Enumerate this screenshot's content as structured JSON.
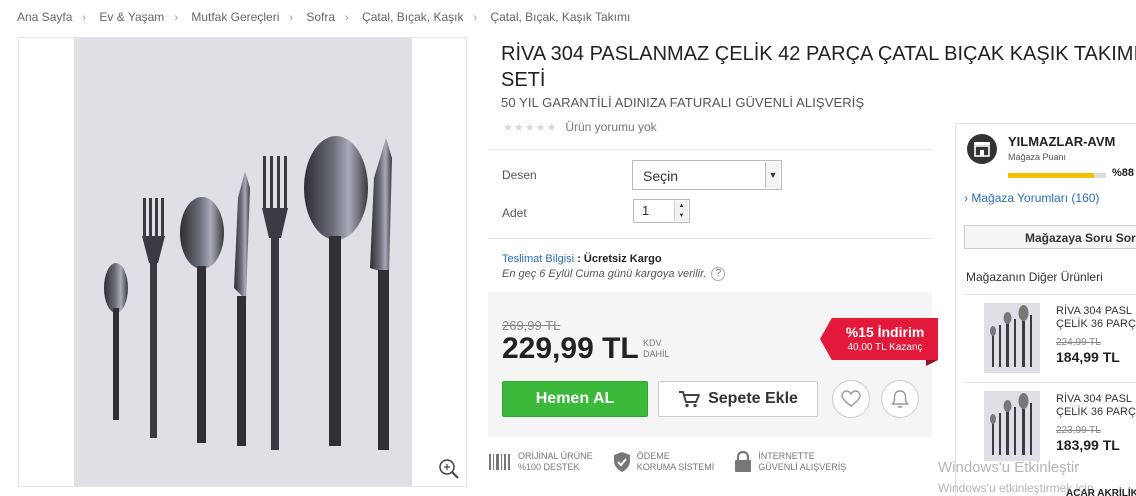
{
  "breadcrumb": [
    "Ana Sayfa",
    "Ev & Yaşam",
    "Mutfak Gereçleri",
    "Sofra",
    "Çatal, Bıçak, Kaşık",
    "Çatal, Bıçak, Kaşık Takımı"
  ],
  "product": {
    "title": "RİVA 304 PASLANMAZ ÇELİK 42 PARÇA ÇATAL BIÇAK KAŞIK TAKIMI SETİ",
    "subtitle": "50 YIL GARANTİLİ ADINIZA FATURALI GÜVENLİ ALIŞVERİŞ",
    "rating_text": "Ürün yorumu yok",
    "stars": "★★★★★"
  },
  "options": {
    "pattern_label": "Desen",
    "pattern_value": "Seçin",
    "qty_label": "Adet",
    "qty_value": "1"
  },
  "delivery": {
    "label": "Teslimat Bilgisi",
    "value": ": Ücretsiz Kargo",
    "note": "En geç 6 Eylül Cuma günü kargoya verilir.",
    "help": "?"
  },
  "price": {
    "old": "269,99 TL",
    "new": "229,99 TL",
    "kdv_1": "KDV",
    "kdv_2": "DAHİL",
    "discount": "%15 İndirim",
    "earn": "40,00 TL Kazanç"
  },
  "actions": {
    "buy": "Hemen AL",
    "cart": "Sepete Ekle"
  },
  "badges": [
    {
      "line1": "ORİJİNAL ÜRÜNE",
      "line2": "%100 DESTEK"
    },
    {
      "line1": "ÖDEME",
      "line2": "KORUMA SİSTEMİ"
    },
    {
      "line1": "İNTERNETTE",
      "line2": "GÜVENLİ ALIŞVERİŞ"
    }
  ],
  "seller": {
    "name": "YILMAZLAR-AVM",
    "score_label": "Mağaza Puanı",
    "score_pct": "%88",
    "score_value": 0.88,
    "reviews": "Mağaza Yorumları (160)",
    "ask": "Mağazaya Soru Sor",
    "other_title": "Mağazanın Diğer Ürünleri",
    "products": [
      {
        "line1": "RİVA 304 PASL",
        "line2": "ÇELİK 36 PARÇ",
        "old": "224,99 TL",
        "new": "184,99 TL"
      },
      {
        "line1": "RİVA 304 PASL",
        "line2": "ÇELİK 36 PARÇ",
        "old": "223,99 TL",
        "new": "183,99 TL"
      }
    ],
    "cut_text": "ACAR AKRİLİK"
  },
  "watermark": {
    "line1": "Windows'u Etkinleştir",
    "line2": "Windows'u etkinleştirmek için"
  },
  "colors": {
    "buy": "#3bb93b",
    "discount": "#e3193b",
    "link": "#2a6ebb",
    "score_bar": "#f2c200"
  }
}
